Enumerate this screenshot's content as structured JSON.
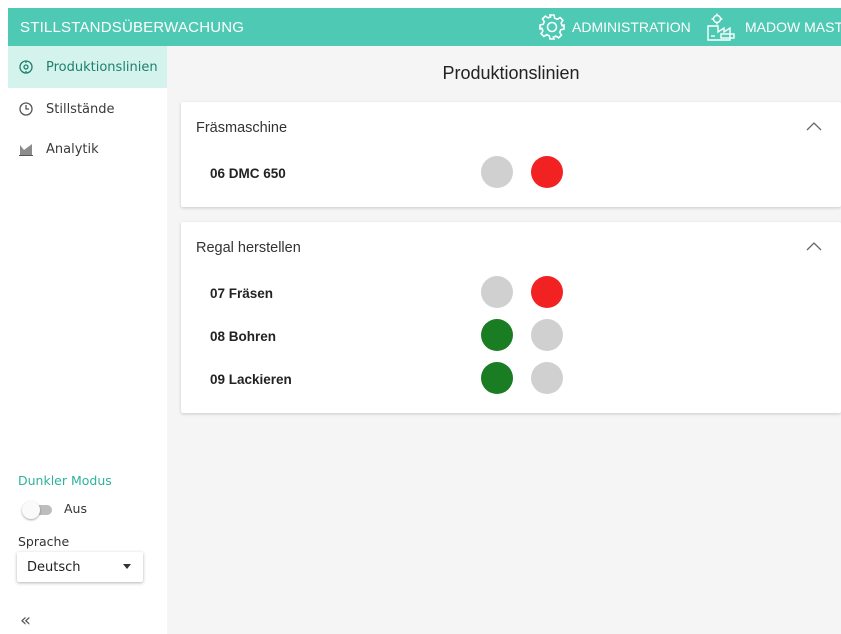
{
  "header": {
    "title": "STILLSTANDSÜBERWACHUNG",
    "admin_label": "ADMINISTRATION",
    "admin_icon": "gear-icon",
    "user_label": "MADOW MASTER",
    "user_icon": "factory-icon"
  },
  "sidebar": {
    "items": [
      {
        "label": "Produktionslinien",
        "icon": "production-line-icon",
        "active": true
      },
      {
        "label": "Stillstände",
        "icon": "clock-icon",
        "active": false
      },
      {
        "label": "Analytik",
        "icon": "chart-icon",
        "active": false
      }
    ],
    "dark_mode_label": "Dunkler Modus",
    "dark_mode_state": "Aus",
    "language_label": "Sprache",
    "language_value": "Deutsch",
    "collapse_glyph": "«"
  },
  "main": {
    "title": "Produktionslinien",
    "groups": [
      {
        "name": "Fräsmaschine",
        "machines": [
          {
            "name": "06 DMC 650",
            "left_status": "off",
            "right_status": "red"
          }
        ]
      },
      {
        "name": "Regal herstellen",
        "machines": [
          {
            "name": "07 Fräsen",
            "left_status": "off",
            "right_status": "red"
          },
          {
            "name": "08 Bohren",
            "left_status": "green",
            "right_status": "off"
          },
          {
            "name": "09 Lackieren",
            "left_status": "green",
            "right_status": "off"
          }
        ]
      }
    ]
  },
  "colors": {
    "accent": "#4ec9b4",
    "active_nav_bg": "#d3f3ec",
    "status_off": "#d0d0d0",
    "status_red": "#f32222",
    "status_green": "#1a7d23"
  }
}
